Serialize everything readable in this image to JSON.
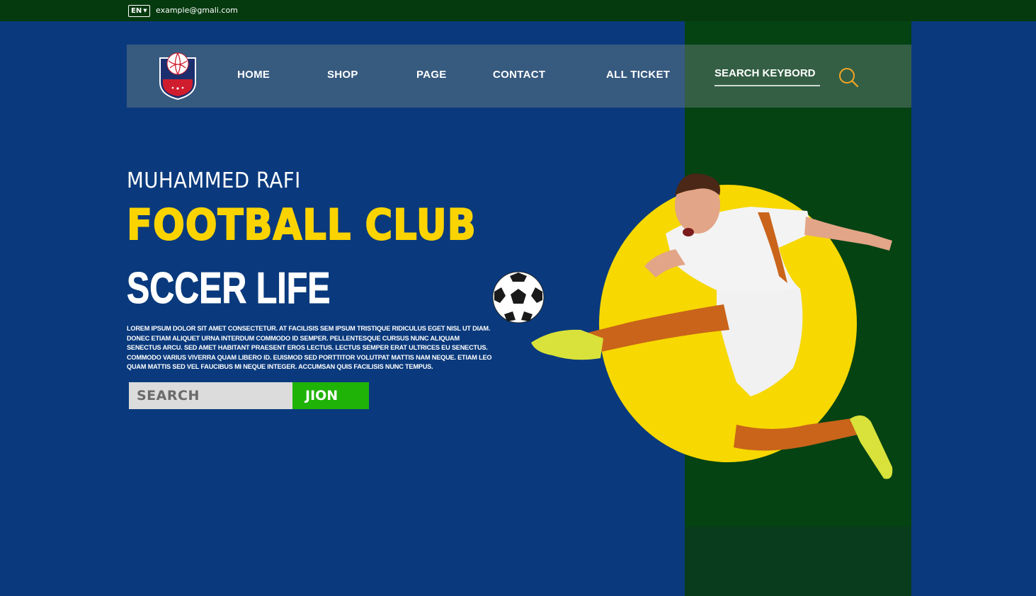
{
  "topbar": {
    "language": "EN",
    "email": "example@gmali.com"
  },
  "nav": {
    "items": [
      "HOME",
      "SHOP",
      "PAGE",
      "CONTACT",
      "ALL TICKET"
    ],
    "search_label": "SEARCH KEYBORD"
  },
  "hero": {
    "subtitle": "MUHAMMED RAFI",
    "title": "FOOTBALL CLUB",
    "tagline": "SCCER LIFE",
    "description": "LOREM IPSUM DOLOR SIT AMET CONSECTETUR. AT FACILISIS SEM IPSUM TRISTIQUE RIDICULUS EGET NISL UT DIAM. DONEC ETIAM ALIQUET URNA INTERDUM COMMODO ID SEMPER. PELLENTESQUE CURSUS NUNC ALIQUAM SENECTUS ARCU. SED AMET HABITANT PRAESENT EROS LECTUS. LECTUS SEMPER ERAT ULTRICES EU SENECTUS. COMMODO VARIUS VIVERRA QUAM LIBERO ID. EUISMOD SED PORTTITOR VOLUTPAT MATTIS NAM NEQUE. ETIAM LEO QUAM MATTIS SED VEL FAUCIBUS MI NEQUE INTEGER. ACCUMSAN QUIS FACILISIS NUNC TEMPUS.",
    "search_placeholder": "SEARCH",
    "join_label": "JION"
  },
  "colors": {
    "background": "#0a3a7d",
    "accent_yellow": "#f7d800",
    "button_green": "#1fb307",
    "dark_green": "#054313"
  },
  "icons": [
    "dropdown-caret-icon",
    "club-logo",
    "search-icon",
    "soccer-ball",
    "football-player"
  ]
}
